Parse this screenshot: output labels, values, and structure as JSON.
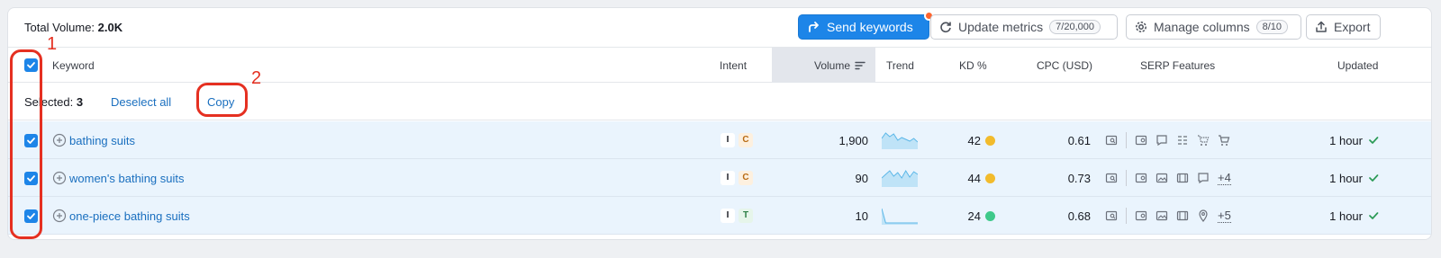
{
  "topbar": {
    "total_label": "Total Volume:",
    "total_value": "2.0K",
    "send_keywords": "Send keywords",
    "update_metrics": "Update metrics",
    "update_metrics_count": "7/20,000",
    "manage_columns": "Manage columns",
    "manage_columns_count": "8/10",
    "export": "Export"
  },
  "columns": {
    "keyword": "Keyword",
    "intent": "Intent",
    "volume": "Volume",
    "trend": "Trend",
    "kd": "KD %",
    "cpc": "CPC (USD)",
    "serp": "SERP Features",
    "updated": "Updated"
  },
  "selection": {
    "label": "Selected:",
    "count": "3",
    "deselect": "Deselect all",
    "copy": "Copy"
  },
  "rows": [
    {
      "keyword": "bathing suits",
      "intents": [
        "I",
        "C"
      ],
      "volume": "1,900",
      "trend": [
        0.6,
        0.9,
        0.7,
        0.85,
        0.5,
        0.65,
        0.55,
        0.45,
        0.6,
        0.4
      ],
      "kd": "42",
      "kd_color": "#f2bb2c",
      "cpc": "0.61",
      "serp_icons": [
        "image-pack-icon",
        "faq-icon",
        "related-searches-icon",
        "shopping-icon",
        "ads-icon"
      ],
      "serp_more": "",
      "updated": "1 hour"
    },
    {
      "keyword": "women's bathing suits",
      "intents": [
        "I",
        "C"
      ],
      "volume": "90",
      "trend": [
        0.5,
        0.7,
        0.9,
        0.6,
        0.8,
        0.5,
        0.9,
        0.55,
        0.85,
        0.7
      ],
      "kd": "44",
      "kd_color": "#f2bb2c",
      "cpc": "0.73",
      "serp_icons": [
        "image-pack-icon",
        "image-icon",
        "video-icon",
        "faq-icon"
      ],
      "serp_more": "+4",
      "updated": "1 hour"
    },
    {
      "keyword": "one-piece bathing suits",
      "intents": [
        "I",
        "T"
      ],
      "volume": "10",
      "trend": [
        0.9,
        0.1,
        0.1,
        0.1,
        0.1,
        0.1,
        0.1,
        0.1,
        0.1,
        0.1
      ],
      "kd": "24",
      "kd_color": "#3fc98a",
      "cpc": "0.68",
      "serp_icons": [
        "image-pack-icon",
        "image-icon",
        "video-icon",
        "local-pack-icon"
      ],
      "serp_more": "+5",
      "updated": "1 hour"
    }
  ],
  "annotations": [
    "1",
    "2"
  ],
  "colors": {
    "accent": "#1d85e8",
    "annotation": "#e53021",
    "row_selected": "#eaf4fd"
  }
}
